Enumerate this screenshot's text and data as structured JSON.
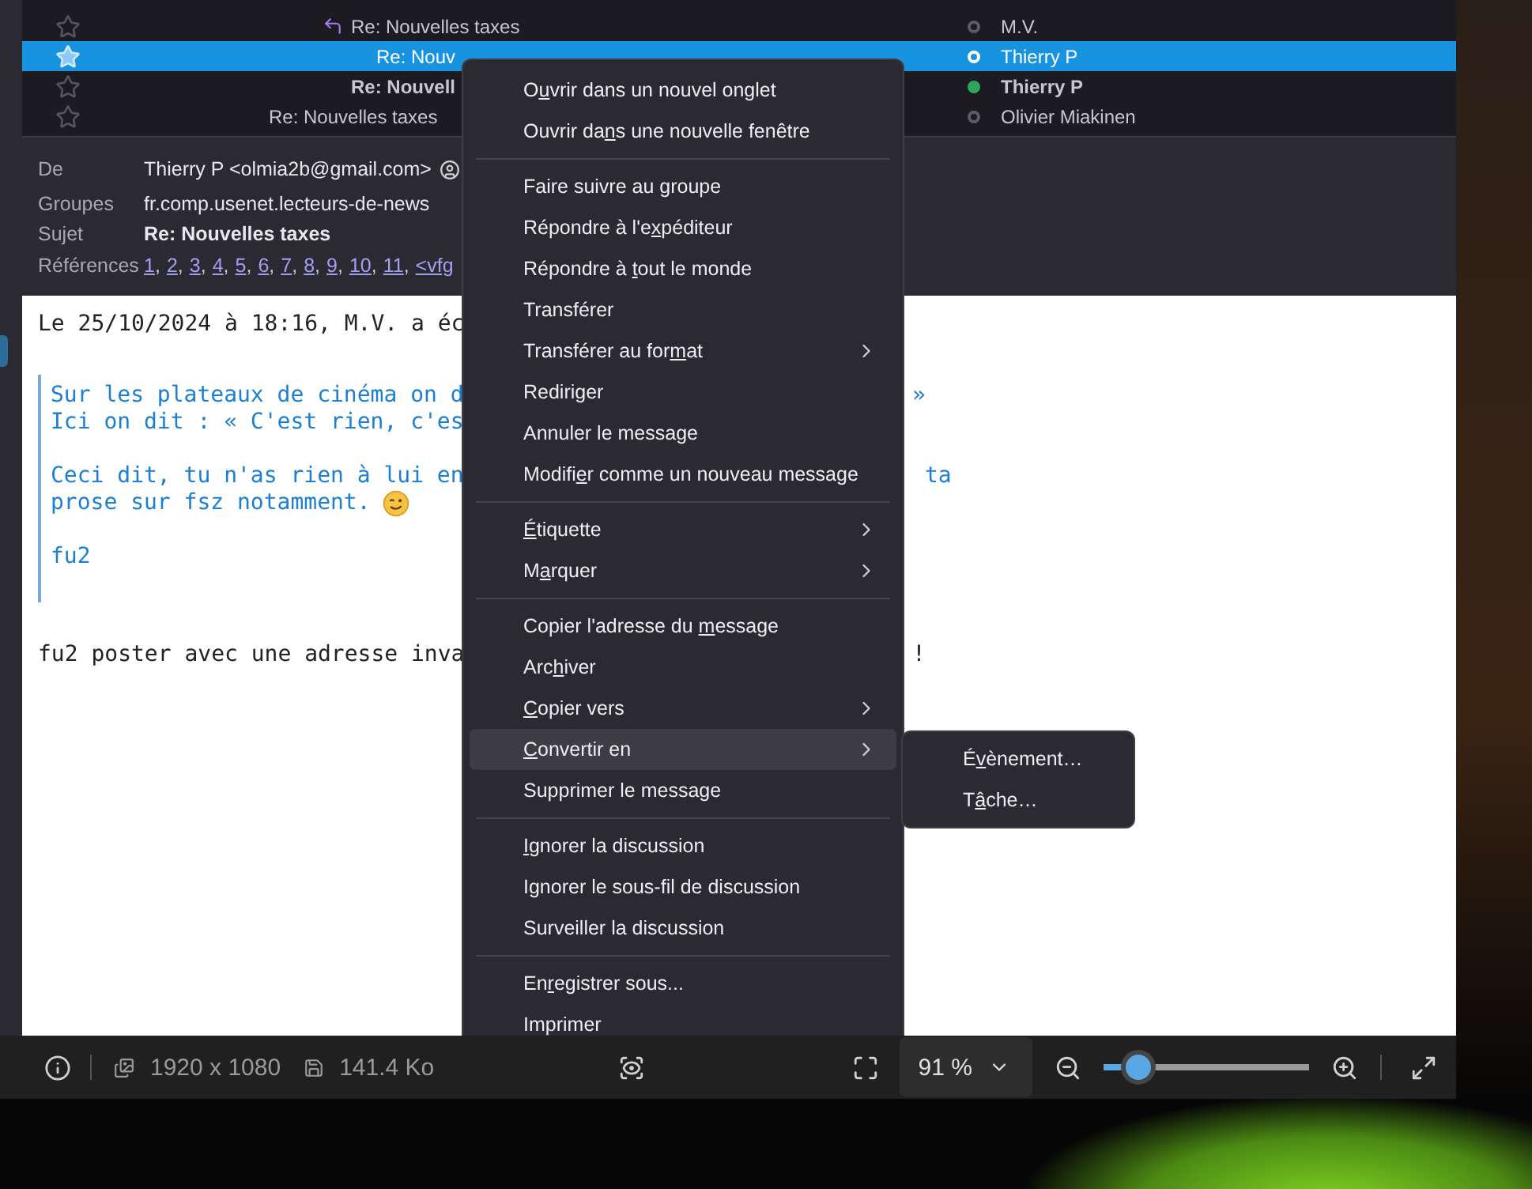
{
  "message_list": {
    "rows": [
      {
        "kind": "reply",
        "subject": "Re: Nouvelles taxes",
        "author": "M.V.",
        "replied": true,
        "unread": false,
        "selected": false,
        "color": "#5c5c64",
        "children": [
          {
            "subject": "Re: Nouv",
            "author": "Thierry P",
            "replied": false,
            "unread": false,
            "selected": true,
            "color": "#ffffff"
          }
        ]
      },
      {
        "kind": "reply",
        "subject": "Re: Nouvell",
        "author": "Thierry P",
        "replied": false,
        "unread": true,
        "selected": false,
        "color": "#2ea65a"
      },
      {
        "kind": "root",
        "subject": "Re: Nouvelles taxes",
        "author": "Olivier Miakinen",
        "replied": false,
        "unread": false,
        "selected": false,
        "color": "#5c5c64"
      }
    ]
  },
  "header": {
    "fields": [
      {
        "kind": "from",
        "label": "De",
        "value": "Thierry P <olmia2b@gmail.com>"
      },
      {
        "kind": "text",
        "label": "Groupes",
        "value": "fr.comp.usenet.lecteurs-de-news"
      },
      {
        "kind": "subject",
        "label": "Sujet",
        "value": "Re: Nouvelles taxes"
      },
      {
        "kind": "links",
        "label": "Références",
        "separator": ",",
        "links": [
          "1",
          "2",
          "3",
          "4",
          "5",
          "6",
          "7",
          "8",
          "9",
          "10",
          "11",
          "<vfg"
        ]
      }
    ]
  },
  "body": {
    "intro": "Le 25/10/2024 à 18:16, M.V. a éc",
    "quote": [
      [
        {
          "text": "Sur les plateaux de cinéma on d",
          "tail": "»"
        },
        {
          "text": "Ici on dit : « C'est rien, c'es"
        }
      ],
      [
        {
          "text": "Ceci dit, tu n'as rien à lui en",
          "tail": "ta"
        },
        {
          "text": "prose sur fsz notamment.",
          "emoji": true
        }
      ],
      [
        {
          "text": "fu2"
        }
      ]
    ],
    "closing": {
      "text": "fu2 poster avec une adresse inva",
      "tail": "!"
    }
  },
  "context_menu": {
    "groups": [
      [
        {
          "label": {
            "before": "O",
            "key": "u",
            "after": "vrir dans un nouvel onglet"
          },
          "submenu": false,
          "selected": false
        },
        {
          "label": {
            "before": "Ouvrir da",
            "key": "n",
            "after": "s une nouvelle fenêtre"
          },
          "submenu": false,
          "selected": false
        }
      ],
      [
        {
          "label": {
            "before": "Faire suivre au groupe"
          },
          "submenu": false,
          "selected": false
        },
        {
          "label": {
            "before": "Répondre à l'e",
            "key": "x",
            "after": "péditeur"
          },
          "submenu": false,
          "selected": false
        },
        {
          "label": {
            "before": "Répondre à ",
            "key": "t",
            "after": "out le monde"
          },
          "submenu": false,
          "selected": false
        },
        {
          "label": {
            "before": "Transférer"
          },
          "submenu": false,
          "selected": false
        },
        {
          "label": {
            "before": "Transférer au for",
            "key": "m",
            "after": "at"
          },
          "submenu": true,
          "selected": false
        },
        {
          "label": {
            "before": "Rediriger"
          },
          "submenu": false,
          "selected": false
        },
        {
          "label": {
            "before": "Annuler le message"
          },
          "submenu": false,
          "selected": false
        },
        {
          "label": {
            "before": "Modifi",
            "key": "e",
            "after": "r comme un nouveau message"
          },
          "submenu": false,
          "selected": false
        }
      ],
      [
        {
          "label": {
            "key": "É",
            "after": "tiquette"
          },
          "submenu": true,
          "selected": false
        },
        {
          "label": {
            "before": "M",
            "key": "a",
            "after": "rquer"
          },
          "submenu": true,
          "selected": false
        }
      ],
      [
        {
          "label": {
            "before": "Copier l'adresse du ",
            "key": "m",
            "after": "essage"
          },
          "submenu": false,
          "selected": false
        },
        {
          "label": {
            "before": "Arc",
            "key": "h",
            "after": "iver"
          },
          "submenu": false,
          "selected": false
        },
        {
          "label": {
            "key": "C",
            "after": "opier vers"
          },
          "submenu": true,
          "selected": false
        },
        {
          "label": {
            "key": "C",
            "after": "onvertir en"
          },
          "submenu": true,
          "selected": true
        },
        {
          "label": {
            "before": "Supprimer le message"
          },
          "submenu": false,
          "selected": false
        }
      ],
      [
        {
          "label": {
            "key": "I",
            "after": "gnorer la discussion"
          },
          "submenu": false,
          "selected": false
        },
        {
          "label": {
            "before": "Ignorer le sous-fil de discussion"
          },
          "submenu": false,
          "selected": false
        },
        {
          "label": {
            "before": "Surveiller la discussion"
          },
          "submenu": false,
          "selected": false
        }
      ],
      [
        {
          "label": {
            "before": "En",
            "key": "r",
            "after": "egistrer sous..."
          },
          "submenu": false,
          "selected": false
        },
        {
          "label": {
            "before": "Imprimer"
          },
          "submenu": false,
          "selected": false
        }
      ]
    ]
  },
  "submenu": {
    "items": [
      {
        "label": {
          "before": "É",
          "key": "v",
          "after": "ènement…"
        }
      },
      {
        "label": {
          "before": "T",
          "key": "â",
          "after": "che…"
        }
      }
    ]
  },
  "toolbar": {
    "dimensions": "1920 x 1080",
    "file_size": "141.4 Ko",
    "zoom": "91 %",
    "zoom_slider": {
      "level": 0.17
    }
  }
}
